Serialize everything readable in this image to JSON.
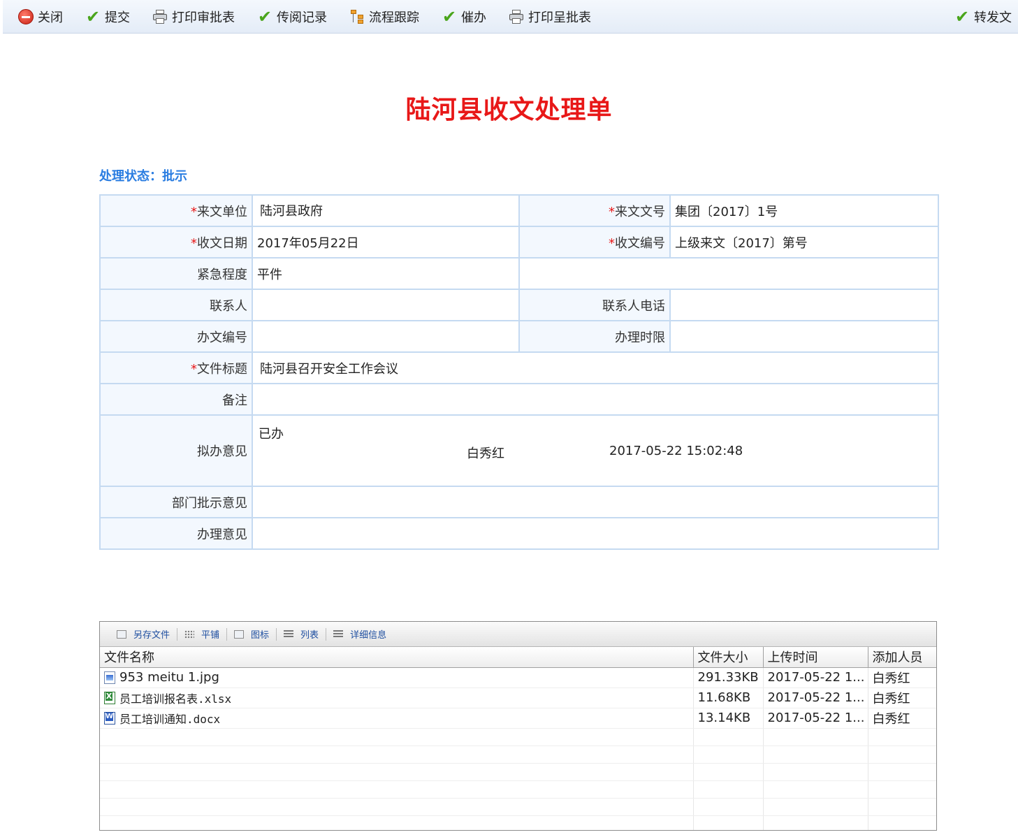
{
  "toolbar": {
    "close": "关闭",
    "submit": "提交",
    "print_approval": "打印审批表",
    "circulation_record": "传阅记录",
    "flow_tracking": "流程跟踪",
    "urge": "催办",
    "print_submit": "打印呈批表",
    "forward": "转发文"
  },
  "doc_title": "陆河县收文处理单",
  "status_text": "处理状态：批示",
  "required_mark": "*",
  "form": {
    "source_unit_label": "来文单位",
    "source_unit_value": "陆河县政府",
    "doc_number_label": "来文文号",
    "doc_number_value": "集团〔2017〕1号",
    "receive_date_label": "收文日期",
    "receive_date_value": "2017年05月22日",
    "receive_number_label": "收文编号",
    "receive_number_value": "上级来文〔2017〕第号",
    "urgency_label": "紧急程度",
    "urgency_value": "平件",
    "contact_label": "联系人",
    "contact_value": "",
    "contact_phone_label": "联系人电话",
    "contact_phone_value": "",
    "office_number_label": "办文编号",
    "office_number_value": "",
    "deadline_label": "办理时限",
    "deadline_value": "",
    "title_label": "文件标题",
    "title_value": "陆河县召开安全工作会议",
    "remark_label": "备注",
    "remark_value": "",
    "proposed_opinion_label": "拟办意见",
    "proposed_opinion_text": "已办",
    "proposed_opinion_user": "白秀红",
    "proposed_opinion_time": "2017-05-22 15:02:48",
    "dept_opinion_label": "部门批示意见",
    "dept_opinion_value": "",
    "handle_opinion_label": "办理意见",
    "handle_opinion_value": ""
  },
  "attachments": {
    "toolbar": {
      "save_as": "另存文件",
      "tile": "平铺",
      "icons": "图标",
      "list": "列表",
      "details": "详细信息"
    },
    "columns": [
      "文件名称",
      "文件大小",
      "上传时间",
      "添加人员"
    ],
    "rows": [
      {
        "icon": "image-file-icon",
        "name": "953 meitu 1.jpg",
        "size": "291.33KB",
        "time": "2017-05-22 1...",
        "user": "白秀红"
      },
      {
        "icon": "excel-file-icon",
        "name": "员工培训报名表.xlsx",
        "size": "11.68KB",
        "time": "2017-05-22 1...",
        "user": "白秀红"
      },
      {
        "icon": "word-file-icon",
        "name": "员工培训通知.docx",
        "size": "13.14KB",
        "time": "2017-05-22 1...",
        "user": "白秀红"
      }
    ]
  },
  "colors": {
    "title_red": "#e81818",
    "status_blue": "#2a7de1",
    "border_blue": "#c5daf1",
    "check_green": "#4aa51c"
  }
}
